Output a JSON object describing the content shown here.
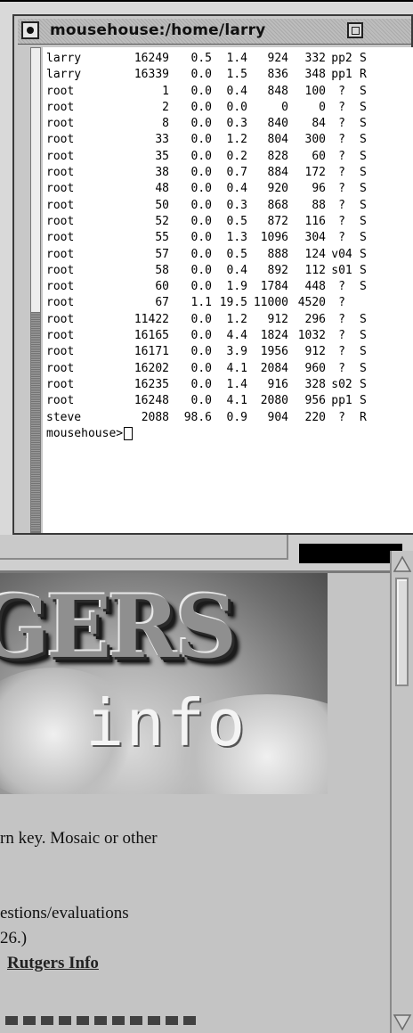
{
  "terminal": {
    "title": "mousehouse:/home/larry",
    "processes": [
      {
        "user": "larry",
        "pid": "16249",
        "cpu": "0.5",
        "mem": "1.4",
        "vsz": "924",
        "rss": "332",
        "tty": "pp2",
        "stat": "S"
      },
      {
        "user": "larry",
        "pid": "16339",
        "cpu": "0.0",
        "mem": "1.5",
        "vsz": "836",
        "rss": "348",
        "tty": "pp1",
        "stat": "R"
      },
      {
        "user": "root",
        "pid": "1",
        "cpu": "0.0",
        "mem": "0.4",
        "vsz": "848",
        "rss": "100",
        "tty": "?",
        "stat": "S"
      },
      {
        "user": "root",
        "pid": "2",
        "cpu": "0.0",
        "mem": "0.0",
        "vsz": "0",
        "rss": "0",
        "tty": "?",
        "stat": "S"
      },
      {
        "user": "root",
        "pid": "8",
        "cpu": "0.0",
        "mem": "0.3",
        "vsz": "840",
        "rss": "84",
        "tty": "?",
        "stat": "S"
      },
      {
        "user": "root",
        "pid": "33",
        "cpu": "0.0",
        "mem": "1.2",
        "vsz": "804",
        "rss": "300",
        "tty": "?",
        "stat": "S"
      },
      {
        "user": "root",
        "pid": "35",
        "cpu": "0.0",
        "mem": "0.2",
        "vsz": "828",
        "rss": "60",
        "tty": "?",
        "stat": "S"
      },
      {
        "user": "root",
        "pid": "38",
        "cpu": "0.0",
        "mem": "0.7",
        "vsz": "884",
        "rss": "172",
        "tty": "?",
        "stat": "S"
      },
      {
        "user": "root",
        "pid": "48",
        "cpu": "0.0",
        "mem": "0.4",
        "vsz": "920",
        "rss": "96",
        "tty": "?",
        "stat": "S"
      },
      {
        "user": "root",
        "pid": "50",
        "cpu": "0.0",
        "mem": "0.3",
        "vsz": "868",
        "rss": "88",
        "tty": "?",
        "stat": "S"
      },
      {
        "user": "root",
        "pid": "52",
        "cpu": "0.0",
        "mem": "0.5",
        "vsz": "872",
        "rss": "116",
        "tty": "?",
        "stat": "S"
      },
      {
        "user": "root",
        "pid": "55",
        "cpu": "0.0",
        "mem": "1.3",
        "vsz": "1096",
        "rss": "304",
        "tty": "?",
        "stat": "S"
      },
      {
        "user": "root",
        "pid": "57",
        "cpu": "0.0",
        "mem": "0.5",
        "vsz": "888",
        "rss": "124",
        "tty": "v04",
        "stat": "S"
      },
      {
        "user": "root",
        "pid": "58",
        "cpu": "0.0",
        "mem": "0.4",
        "vsz": "892",
        "rss": "112",
        "tty": "s01",
        "stat": "S"
      },
      {
        "user": "root",
        "pid": "60",
        "cpu": "0.0",
        "mem": "1.9",
        "vsz": "1784",
        "rss": "448",
        "tty": "?",
        "stat": "S"
      },
      {
        "user": "root",
        "pid": "67",
        "cpu": "1.1",
        "mem": "19.5",
        "vsz": "11000",
        "rss": "4520",
        "tty": "?",
        "stat": ""
      },
      {
        "user": "root",
        "pid": "11422",
        "cpu": "0.0",
        "mem": "1.2",
        "vsz": "912",
        "rss": "296",
        "tty": "?",
        "stat": "S"
      },
      {
        "user": "root",
        "pid": "16165",
        "cpu": "0.0",
        "mem": "4.4",
        "vsz": "1824",
        "rss": "1032",
        "tty": "?",
        "stat": "S"
      },
      {
        "user": "root",
        "pid": "16171",
        "cpu": "0.0",
        "mem": "3.9",
        "vsz": "1956",
        "rss": "912",
        "tty": "?",
        "stat": "S"
      },
      {
        "user": "root",
        "pid": "16202",
        "cpu": "0.0",
        "mem": "4.1",
        "vsz": "2084",
        "rss": "960",
        "tty": "?",
        "stat": "S"
      },
      {
        "user": "root",
        "pid": "16235",
        "cpu": "0.0",
        "mem": "1.4",
        "vsz": "916",
        "rss": "328",
        "tty": "s02",
        "stat": "S"
      },
      {
        "user": "root",
        "pid": "16248",
        "cpu": "0.0",
        "mem": "4.1",
        "vsz": "2080",
        "rss": "956",
        "tty": "pp1",
        "stat": "S"
      },
      {
        "user": "steve",
        "pid": "2088",
        "cpu": "98.6",
        "mem": "0.9",
        "vsz": "904",
        "rss": "220",
        "tty": "?",
        "stat": "R"
      }
    ],
    "prompt": "mousehouse>"
  },
  "browser": {
    "banner": {
      "big_text": "GERS",
      "small_text": "info"
    },
    "text_line_1": "rn key. Mosaic or other",
    "text_line_2": "estions/evaluations",
    "text_line_3": " 26.)",
    "link_text": "Rutgers Info"
  },
  "icons": {
    "window_menu": "window-menu-icon",
    "maximize": "maximize-icon",
    "scroll_up": "scroll-up-arrow-icon",
    "scroll_down": "scroll-down-arrow-icon"
  }
}
